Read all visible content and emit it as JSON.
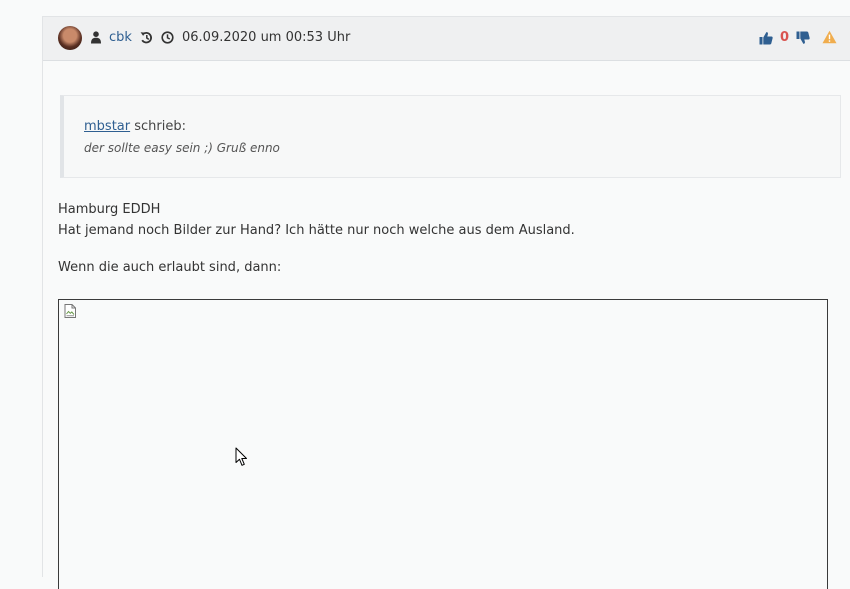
{
  "post": {
    "author": "cbk",
    "date": "06.09.2020 um 00:53 Uhr",
    "vote_count": "0",
    "icons": {
      "avatar": "user-avatar-photo",
      "user": "user-icon",
      "history": "history-icon",
      "clock": "clock-icon",
      "upvote": "thumbs-up-icon",
      "downvote": "thumbs-down-icon",
      "report": "warning-icon"
    },
    "colors": {
      "link": "#2f5f91",
      "vote_count": "#d9534f",
      "warning": "#f0ad4e"
    }
  },
  "quote": {
    "author": "mbstar",
    "wrote": " schrieb:",
    "text": "der sollte easy sein ;) Gruß enno"
  },
  "body": {
    "line1": "Hamburg EDDH",
    "line2": "Hat jemand noch Bilder zur Hand? Ich hätte nur noch welche aus dem Ausland.",
    "line3": "Wenn die auch erlaubt sind, dann:"
  },
  "embedded_image": {
    "icon": "broken-image-icon"
  }
}
